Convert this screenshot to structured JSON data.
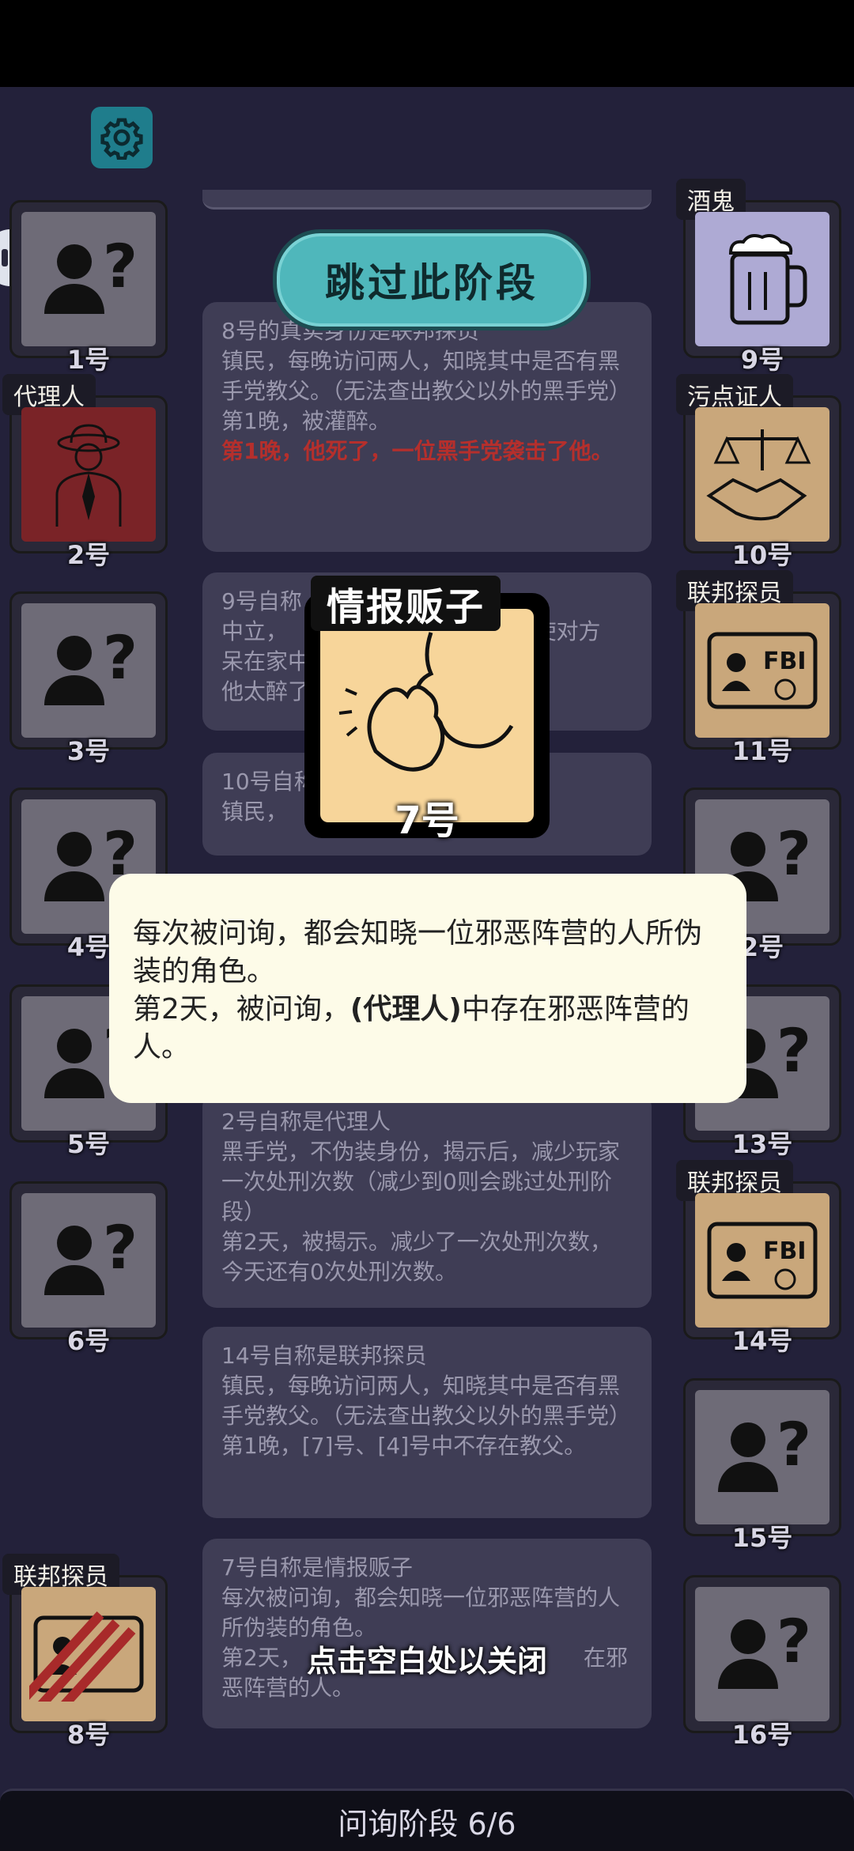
{
  "settings_icon": "gear-icon",
  "skip_button": "跳过此阶段",
  "players_left": [
    {
      "num": "1号",
      "role": "",
      "icon": "unknown-person-icon"
    },
    {
      "num": "2号",
      "role": "代理人",
      "icon": "agent-icon"
    },
    {
      "num": "3号",
      "role": "",
      "icon": "unknown-person-icon"
    },
    {
      "num": "4号",
      "role": "",
      "icon": "unknown-person-icon"
    },
    {
      "num": "5号",
      "role": "",
      "icon": "unknown-person-icon"
    },
    {
      "num": "6号",
      "role": "",
      "icon": "unknown-person-icon"
    },
    {
      "num": "8号",
      "role": "联邦探员",
      "icon": "fbi-badge-icon"
    }
  ],
  "players_right": [
    {
      "num": "9号",
      "role": "酒鬼",
      "icon": "beer-mug-icon"
    },
    {
      "num": "10号",
      "role": "污点证人",
      "icon": "scales-handshake-icon"
    },
    {
      "num": "11号",
      "role": "联邦探员",
      "icon": "fbi-badge-icon"
    },
    {
      "num": "2号",
      "role": "",
      "icon": "unknown-person-icon"
    },
    {
      "num": "13号",
      "role": "",
      "icon": "unknown-person-icon"
    },
    {
      "num": "14号",
      "role": "联邦探员",
      "icon": "fbi-badge-icon"
    },
    {
      "num": "15号",
      "role": "",
      "icon": "unknown-person-icon"
    },
    {
      "num": "16号",
      "role": "",
      "icon": "unknown-person-icon"
    }
  ],
  "logs": {
    "entry1": {
      "text": "8号的真实身份是联邦探员\n镇民，每晚访问两人，知晓其中是否有黑手党教父。（无法查出教父以外的黑手党）\n第1晚，被灌醉。",
      "red": "第1晚，他死了，一位黑手党袭击了他。"
    },
    "entry2": {
      "text": "9号自称\n中立，                                   使对方\n呆在家中\n他太醉了"
    },
    "entry3": {
      "text": "10号自称\n镇民，"
    },
    "entry4": {
      "text": "2号自称是代理人\n黑手党，不伪装身份，揭示后，减少玩家一次处刑次数（减少到0则会跳过处刑阶段）\n第2天，被揭示。减少了一次处刑次数，今天还有0次处刑次数。"
    },
    "entry5": {
      "text": "14号自称是联邦探员\n镇民，每晚访问两人，知晓其中是否有黑手党教父。（无法查出教父以外的黑手党）\n第1晚，[7]号、[4]号中不存在教父。"
    },
    "entry6": {
      "text": "7号自称是情报贩子\n每次被问询，都会知晓一位邪恶阵营的人所伪装的角色。\n第2天，                                        在邪恶阵营的人。"
    }
  },
  "card": {
    "title": "情报贩子",
    "num": "7号",
    "icon": "whisper-icon"
  },
  "popup": {
    "line1": "每次被问询，都会知晓一位邪恶阵营的人所伪装的角色。",
    "line2_pre": "第2天，被问询，",
    "line2_bold": "(代理人)",
    "line2_post": "中存在邪恶阵营的人。"
  },
  "close_hint": "点击空白处以关闭",
  "phase": "问询阶段 6/6",
  "colors": {
    "background": "#23213a",
    "skip_button": "#4fb7bb",
    "popup": "#fdfbe8",
    "card": "#f7d59a",
    "red_text": "#b52f2c"
  }
}
